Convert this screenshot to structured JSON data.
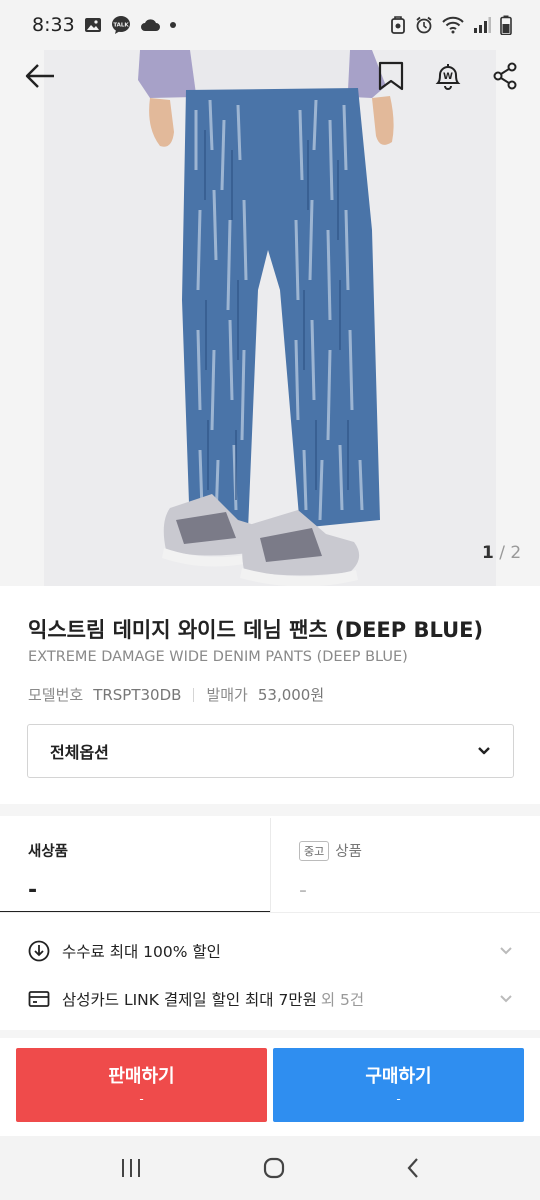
{
  "status_bar": {
    "time": "8:33",
    "talk_label": "TALK"
  },
  "gallery": {
    "current": "1",
    "total": "2"
  },
  "watch_badge": "W",
  "product": {
    "title_ko": "익스트림 데미지 와이드 데님 팬츠 (DEEP BLUE)",
    "title_en": "EXTREME DAMAGE WIDE DENIM PANTS (DEEP BLUE)",
    "model_label": "모델번호",
    "model_value": "TRSPT30DB",
    "release_price_label": "발매가",
    "release_price_value": "53,000원"
  },
  "option_select": {
    "label": "전체옵션"
  },
  "tabs": {
    "new": {
      "label": "새상품",
      "price": "-"
    },
    "used": {
      "badge": "중고",
      "label": "상품",
      "price": "-"
    }
  },
  "benefits": [
    {
      "text": "수수료 최대 100% 할인",
      "more": ""
    },
    {
      "text": "삼성카드 LINK 결제일 할인 최대 7만원",
      "more": "외 5건"
    }
  ],
  "actions": {
    "sell": {
      "label": "판매하기",
      "price": "-"
    },
    "buy": {
      "label": "구매하기",
      "price": "-"
    }
  },
  "colors": {
    "sell": "#ef4b4b",
    "buy": "#2f8ef0",
    "denim": "#4a74a8"
  }
}
